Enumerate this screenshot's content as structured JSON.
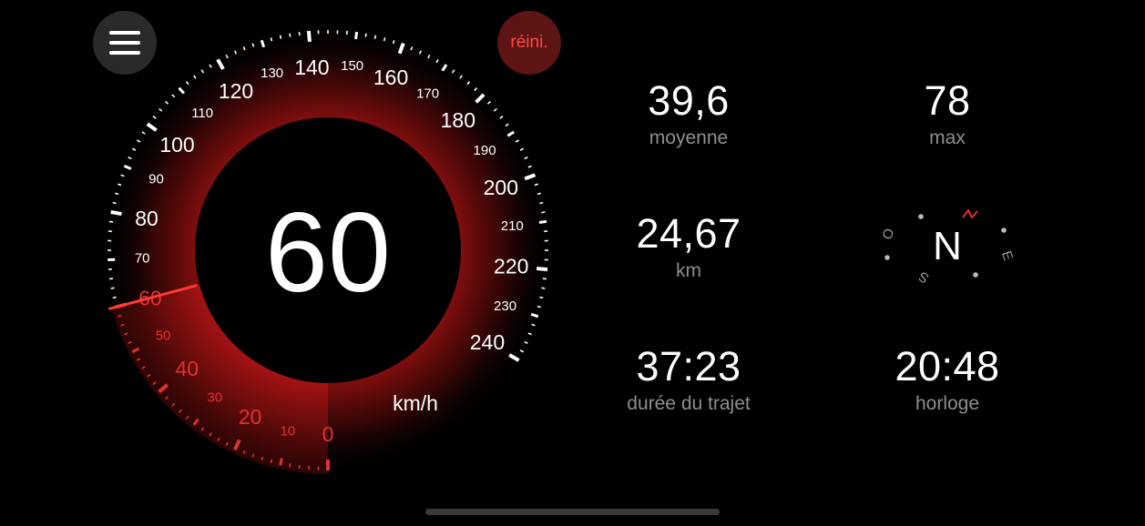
{
  "menu": {
    "icon": "hamburger-menu-icon"
  },
  "reset": {
    "label": "réini."
  },
  "speedometer": {
    "speed": "60",
    "unit": "km/h",
    "max_scale": 240,
    "major_labels": [
      "0",
      "20",
      "40",
      "60",
      "80",
      "100",
      "120",
      "140",
      "160",
      "180",
      "200",
      "220",
      "240"
    ],
    "minor_labels": [
      "10",
      "30",
      "50",
      "70",
      "90",
      "110",
      "130",
      "150",
      "170",
      "190",
      "210",
      "230"
    ],
    "colors": {
      "active": "#e0322f",
      "inactive": "#ffffff"
    }
  },
  "stats": {
    "average": {
      "value": "39,6",
      "label": "moyenne"
    },
    "max": {
      "value": "78",
      "label": "max"
    },
    "distance": {
      "value": "24,67",
      "label": "km"
    },
    "duration": {
      "value": "37:23",
      "label": "durée du trajet"
    },
    "clock": {
      "value": "20:48",
      "label": "horloge"
    }
  },
  "compass": {
    "heading": "N",
    "labels": {
      "north": "N",
      "east": "E",
      "south": "S",
      "west": "O"
    }
  }
}
